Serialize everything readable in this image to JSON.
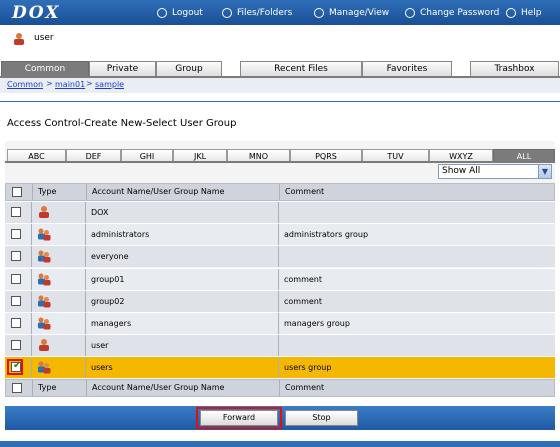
{
  "app": {
    "logo": "DOX"
  },
  "topnav": {
    "logout": "Logout",
    "files_folders": "Files/Folders",
    "manage_view": "Manage/View",
    "change_password": "Change Password",
    "help": "Help"
  },
  "user": {
    "name": "user"
  },
  "main_tabs": [
    "Common",
    "Private",
    "Group",
    "Recent Files",
    "Favorites",
    "Trashbox"
  ],
  "breadcrumb": {
    "items": [
      "Common",
      "main01",
      "sample"
    ],
    "separator": ">"
  },
  "page_title": "Access Control-Create New-Select User Group",
  "alpha_tabs": [
    "ABC",
    "DEF",
    "GHI",
    "JKL",
    "MNO",
    "PQRS",
    "TUV",
    "WXYZ",
    "ALL"
  ],
  "filter": {
    "selected": "Show All"
  },
  "table": {
    "headers": {
      "type": "Type",
      "name": "Account Name/User Group Name",
      "comment": "Comment"
    },
    "rows": [
      {
        "name": "DOX",
        "comment": "",
        "kind": "user-icon",
        "checked": false
      },
      {
        "name": "administrators",
        "comment": "administrators group",
        "kind": "group-icon",
        "checked": false
      },
      {
        "name": "everyone",
        "comment": "",
        "kind": "group-icon",
        "checked": false
      },
      {
        "name": "group01",
        "comment": "comment",
        "kind": "group-icon",
        "checked": false
      },
      {
        "name": "group02",
        "comment": "comment",
        "kind": "group-icon",
        "checked": false
      },
      {
        "name": "managers",
        "comment": "managers group",
        "kind": "group-icon",
        "checked": false
      },
      {
        "name": "user",
        "comment": "",
        "kind": "user-icon",
        "checked": false
      },
      {
        "name": "users",
        "comment": "users group",
        "kind": "group-icon",
        "checked": true
      }
    ]
  },
  "buttons": {
    "forward": "Forward",
    "stop": "Stop"
  },
  "colors": {
    "accent": "#2f6fb8",
    "selected_row": "#f5b800",
    "highlight": "#e01010"
  }
}
